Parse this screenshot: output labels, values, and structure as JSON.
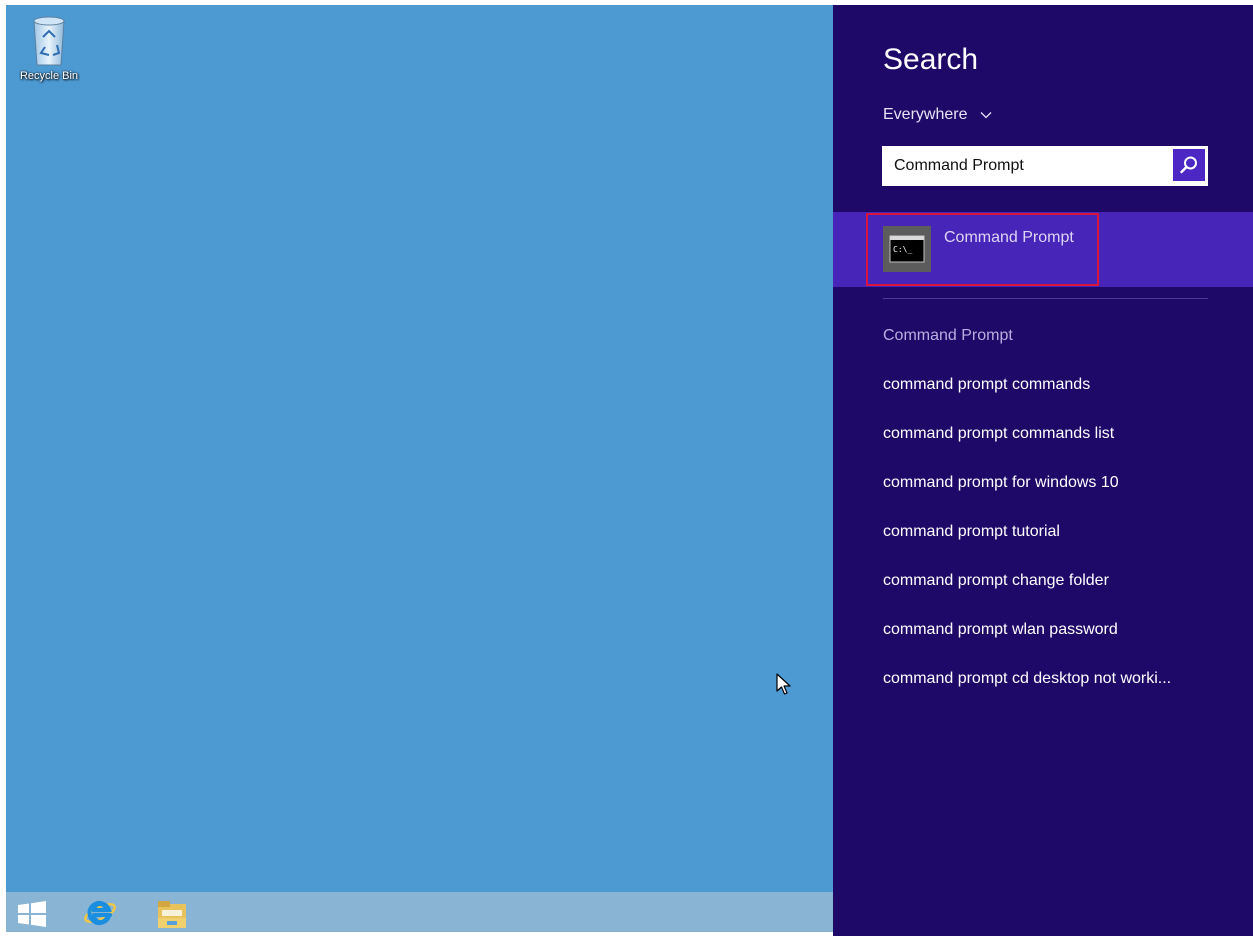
{
  "desktop": {
    "background_color": "#4d9ad3",
    "icons": [
      {
        "label": "Recycle Bin",
        "icon": "recycle-bin-icon"
      }
    ]
  },
  "taskbar": {
    "items": [
      {
        "icon": "windows-start-icon"
      },
      {
        "icon": "internet-explorer-icon"
      },
      {
        "icon": "file-explorer-icon"
      }
    ]
  },
  "search_pane": {
    "title": "Search",
    "scope": "Everywhere",
    "scope_icon": "chevron-down-icon",
    "query": "Command Prompt",
    "search_button_icon": "magnifier-icon",
    "top_result": {
      "label": "Command Prompt",
      "icon": "command-prompt-icon",
      "icon_text": "C:\\_"
    },
    "suggestions": [
      "Command Prompt",
      "command prompt commands",
      "command prompt commands list",
      "command prompt for windows 10",
      "command prompt tutorial",
      "command prompt change folder",
      "command prompt wlan password",
      "command prompt cd desktop not worki..."
    ],
    "colors": {
      "pane_background": "#1e0969",
      "selected_result": "#4625b8",
      "search_button": "#4d27c4",
      "highlight_border": "#d9143f"
    }
  }
}
